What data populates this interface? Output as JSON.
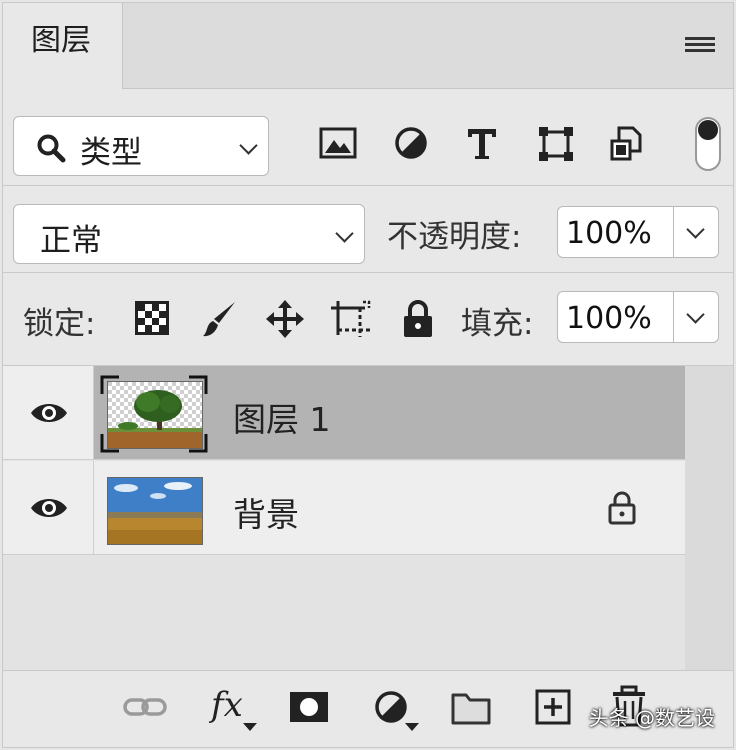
{
  "panel": {
    "tab_title": "图层",
    "menu_icon": "hamburger-menu-icon"
  },
  "filter": {
    "search_icon": "search-icon",
    "kind_label": "类型",
    "filter_icons": [
      "image-filter-icon",
      "adjustment-filter-icon",
      "type-filter-icon",
      "shape-filter-icon",
      "smart-object-filter-icon"
    ],
    "toggle_icon": "filter-toggle-icon"
  },
  "blend": {
    "mode": "正常",
    "opacity_label": "不透明度:",
    "opacity_value": "100%"
  },
  "lock": {
    "label": "锁定:",
    "icons": [
      "lock-transparent-pixels-icon",
      "lock-image-pixels-icon",
      "lock-position-icon",
      "lock-artboard-icon",
      "lock-all-icon"
    ],
    "fill_label": "填充:",
    "fill_value": "100%"
  },
  "layers": [
    {
      "name": "图层 1",
      "selected": true,
      "locked": false,
      "thumb": "tree-on-transparent-thumbnail"
    },
    {
      "name": "背景",
      "selected": false,
      "locked": true,
      "thumb": "field-and-sky-thumbnail"
    }
  ],
  "footer": {
    "icons": [
      "link-layers-icon",
      "fx-icon",
      "add-mask-icon",
      "new-adjustment-icon",
      "new-group-folder-icon",
      "new-layer-icon",
      "delete-layer-icon"
    ],
    "fx_text": "fx"
  },
  "watermark": "头条 @数艺设",
  "colors": {
    "panel_bg": "#e8e8e8",
    "selected_row": "#b3b3b3",
    "input_bg": "#ffffff"
  }
}
